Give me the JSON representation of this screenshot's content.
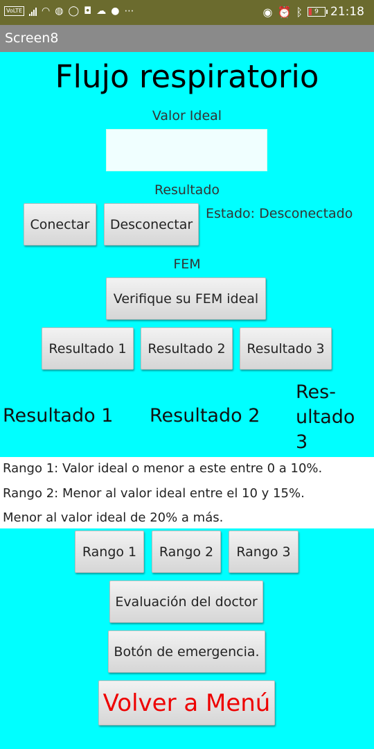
{
  "status_bar": {
    "volte": "VoLTE",
    "battery": "9",
    "time": "21:18"
  },
  "app_title": "Screen8",
  "heading": "Flujo respiratorio",
  "valor_ideal_label": "Valor Ideal",
  "valor_ideal_value": "",
  "resultado_label": "Resultado",
  "connect_button": "Conectar",
  "disconnect_button": "Desconectar",
  "estado_text": "Estado: Desconectado",
  "fem_label": "FEM",
  "verify_button": "Verifique su FEM ideal",
  "result_buttons": [
    "Resultado 1",
    "Resultado 2",
    "Resultado 3"
  ],
  "result_labels": {
    "r1": "Resultado 1",
    "r2": "Resultado 2",
    "r3_line1": "Res-",
    "r3_line2": "ultado",
    "r3_line3": "3"
  },
  "ranges_text": [
    "Rango 1: Valor ideal o menor a este entre 0 a 10%.",
    "Rango 2: Menor al valor ideal entre el 10 y 15%.",
    "Menor al valor ideal de 20% a más."
  ],
  "range_buttons": [
    "Rango 1",
    "Rango 2",
    "Rango 3"
  ],
  "doctor_button": "Evaluación del doctor",
  "emergency_button": "Botón de emergencia.",
  "menu_button": "Volver a Menú",
  "colors": {
    "background": "#00FFFF",
    "status_bar": "#6B6B2E",
    "title_bar": "#8a8a8a",
    "menu_text": "#ee0000"
  }
}
